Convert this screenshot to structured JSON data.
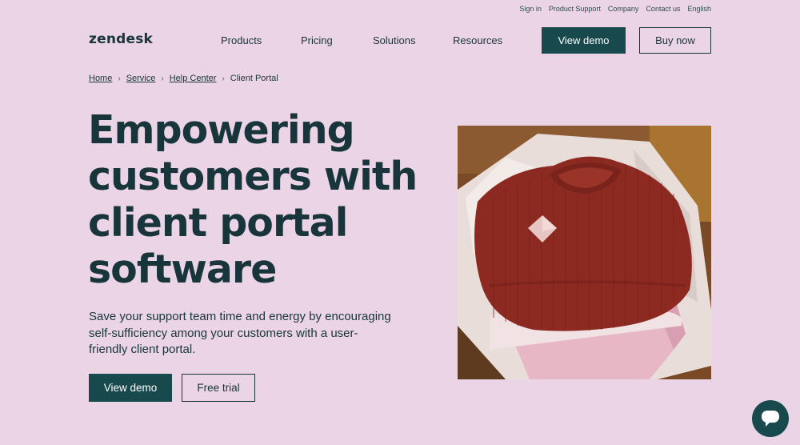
{
  "utility_nav": [
    "Sign in",
    "Product Support",
    "Company",
    "Contact us",
    "English"
  ],
  "logo": {
    "text": "zendesk"
  },
  "nav": {
    "items": [
      "Products",
      "Pricing",
      "Solutions",
      "Resources"
    ]
  },
  "header_buttons": {
    "view_demo": "View demo",
    "buy_now": "Buy now"
  },
  "breadcrumb": [
    "Home",
    "Service",
    "Help Center",
    "Client Portal"
  ],
  "hero": {
    "title_lines": [
      "Empowering",
      "customers with",
      "client portal",
      "software"
    ],
    "subtitle": "Save your support team time and energy by encouraging self-sufficiency among your customers with a user-friendly client portal.",
    "primary_cta": "View demo",
    "secondary_cta": "Free trial"
  },
  "chat": {
    "icon": "chat-bubble-icon"
  },
  "colors": {
    "background": "#ecd4e7",
    "primary": "#17494d",
    "text": "#17353a"
  }
}
